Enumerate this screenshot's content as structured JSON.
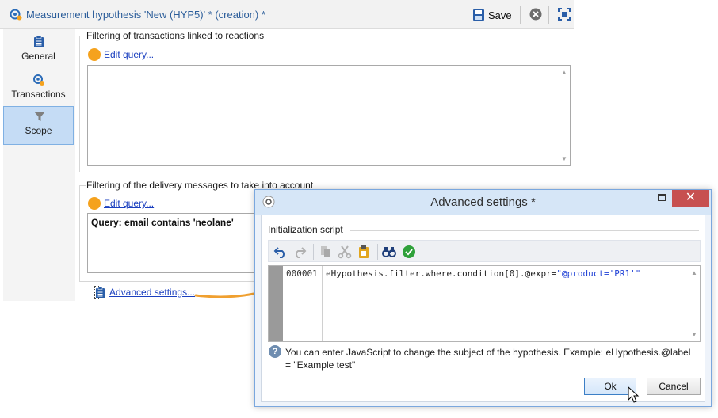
{
  "main": {
    "title": "Measurement hypothesis 'New (HYP5)' * (creation) *",
    "save_label": "Save",
    "icons": {
      "title": "hypothesis-icon",
      "save": "floppy-disk-icon",
      "close": "close-circle-icon",
      "maximize": "maximize-icon"
    }
  },
  "sidebar": {
    "items": [
      {
        "label": "General",
        "icon": "clipboard-icon",
        "selected": false
      },
      {
        "label": "Transactions",
        "icon": "transactions-icon",
        "selected": false
      },
      {
        "label": "Scope",
        "icon": "funnel-icon",
        "selected": true
      }
    ]
  },
  "sections": {
    "transactions": {
      "title": "Filtering of transactions linked to reactions",
      "edit_link": "Edit query..."
    },
    "delivery": {
      "title": "Filtering of the delivery messages to take into account",
      "edit_link": "Edit query...",
      "query": "Query: email contains 'neolane'"
    },
    "advanced_link": "Advanced settings..."
  },
  "dialog": {
    "title": "Advanced settings *",
    "init_title": "Initialization script",
    "toolbar": [
      "undo-icon",
      "redo-icon",
      "copy-icon",
      "cut-icon",
      "paste-icon",
      "find-icon",
      "validate-icon"
    ],
    "editor": {
      "line_number": "000001",
      "code_prefix": "eHypothesis.filter.where.condition[0].@expr=",
      "code_string": "\"@product='PR1'\""
    },
    "help": "You can enter JavaScript to change the subject of the hypothesis. Example: eHypothesis.@label = \"Example test\"",
    "ok_label": "Ok",
    "cancel_label": "Cancel",
    "colors": {
      "accent": "#3c7fc6",
      "close": "#c75050",
      "link": "#1a3fbf",
      "orange": "#f5a21d"
    }
  }
}
